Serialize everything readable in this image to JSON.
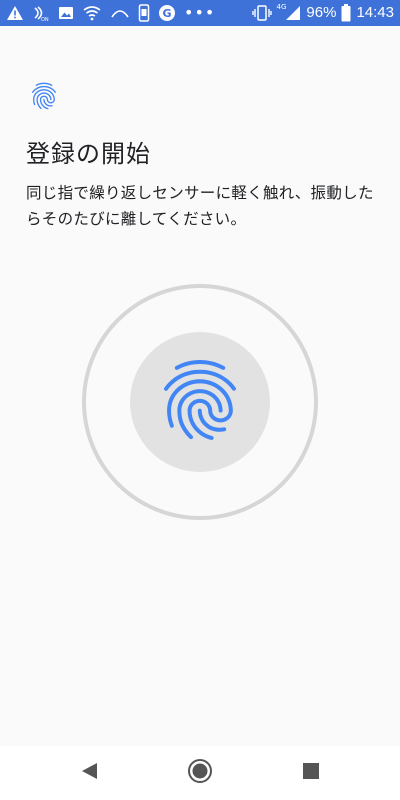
{
  "status_bar": {
    "network_label": "4G",
    "battery": "96%",
    "clock": "14:43",
    "icons": [
      "warning-icon",
      "nfc-icon",
      "image-icon",
      "wifi-icon",
      "hotspot-icon",
      "screenshot-icon",
      "grammarly-icon",
      "more-dots-icon",
      "vibrate-icon",
      "signal-icon",
      "battery-icon"
    ]
  },
  "header": {
    "icon": "fingerprint-icon",
    "title": "登録の開始",
    "description": "同じ指で繰り返しセンサーに軽く触れ、振動したらそのたびに離してください。"
  },
  "sensor": {
    "icon": "fingerprint-icon"
  },
  "nav_bar": {
    "icons": [
      "back-icon",
      "home-icon",
      "recents-icon"
    ]
  },
  "colors": {
    "status_bar": "#3f72d8",
    "accent": "#4285f4",
    "ring": "#d6d6d6",
    "core": "#e2e2e2",
    "background": "#fafafa",
    "nav_icons": "#555555"
  }
}
